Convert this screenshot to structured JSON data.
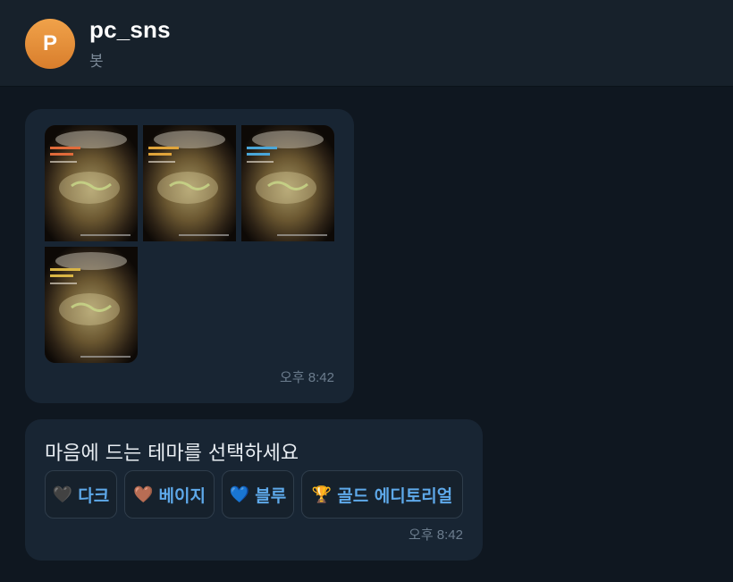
{
  "header": {
    "avatar_letter": "P",
    "title": "pc_sns",
    "subtitle": "봇"
  },
  "photo_message": {
    "image_count": 4,
    "time": "오후 8:42"
  },
  "theme_message": {
    "text": "마음에 드는 테마를 선택하세요",
    "buttons": [
      {
        "emoji": "🖤",
        "label": "다크"
      },
      {
        "emoji": "🤎",
        "label": "베이지"
      },
      {
        "emoji": "💙",
        "label": "블루"
      },
      {
        "emoji": "🏆",
        "label": "골드 에디토리얼"
      }
    ],
    "time": "오후 8:42"
  },
  "colors": {
    "background": "#0f1720",
    "header": "#17212b",
    "bubble": "#182533",
    "avatar": "#e58b36",
    "button_text": "#5ea9ea",
    "timestamp": "#6c7d8e"
  }
}
